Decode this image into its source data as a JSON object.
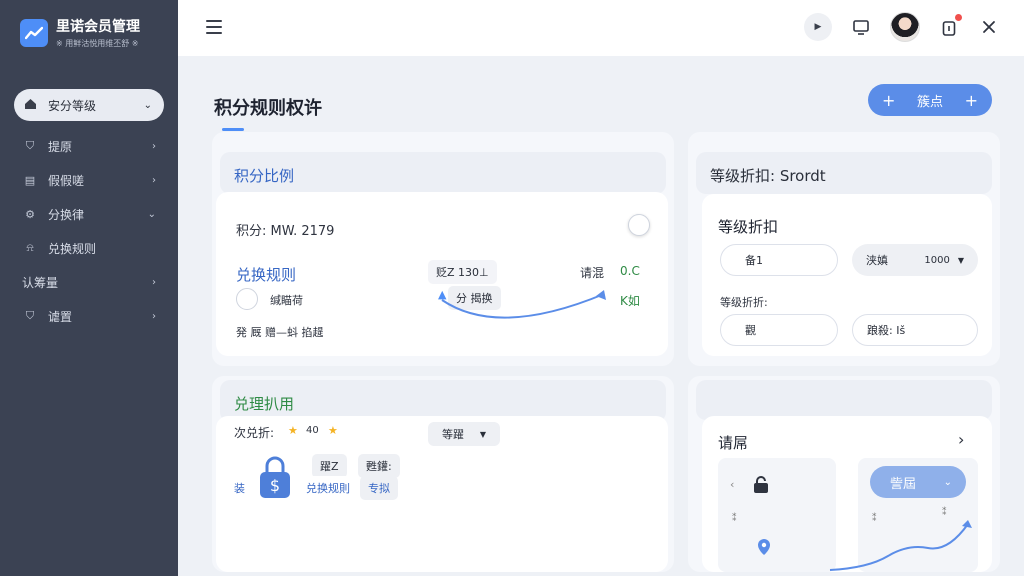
{
  "app": {
    "title": "里诺会员管理",
    "subtitle": "※ 用鲜沽悦用维丕舒 ※"
  },
  "sidebar": {
    "items": [
      {
        "label": "安分等级",
        "icon": "home-icon",
        "chevron": "⌄",
        "active": true
      },
      {
        "label": "提原",
        "icon": "shield-icon",
        "chevron": "›"
      },
      {
        "label": "假假嗟",
        "icon": "list-icon",
        "chevron": "›"
      },
      {
        "label": "分换律",
        "icon": "gear-icon",
        "chevron": "⌄"
      },
      {
        "label": "兑换规则",
        "icon": "lock-icon",
        "chevron": "›"
      },
      {
        "label": "认筹量",
        "icon": "",
        "chevron": "›"
      },
      {
        "label": "谑置",
        "icon": "settings-icon",
        "chevron": "›"
      }
    ]
  },
  "page": {
    "title": "积分规则权许",
    "add_button": "簇点"
  },
  "left_card": {
    "header": "积分比例",
    "points_label": "积分: MW. 2179",
    "rule_title": "兑换规则",
    "radio_label": "缄瞄荷",
    "bottom_text": "発 厩 赠—蚪 掐趧",
    "mid_label1": "贬Z 130⊥",
    "mid_label2": "分 揭换",
    "right_label1": "请混",
    "right_value": "0.C",
    "right_label2": "K如"
  },
  "bottom_left_card": {
    "header": "兑理扒用",
    "discount_label": "次兑折:",
    "discount_value": "40",
    "select_value": "等躍",
    "tag1": "躍Z",
    "tag2": "甦鑵:",
    "row_prefix": "装",
    "row_label1": "兑换规則",
    "row_label2": "专拟"
  },
  "right_card": {
    "header": "等级折扣: Srordt",
    "section_title": "等级折扣",
    "field1": "备1",
    "select_label": "浃嫃",
    "select_value": "1000",
    "subtitle": "等级折折:",
    "field2": "觀",
    "field3": "踉殺: Iš"
  },
  "bottom_right_card": {
    "title": "请屌",
    "button": "訾屆",
    "tiny1": "⁑",
    "tiny2": "⁑",
    "tiny3": "⁑"
  },
  "colors": {
    "accent": "#5b8de8",
    "sidebar": "#3b4253",
    "blue_text": "#3666c4",
    "green_text": "#2f8b45"
  }
}
